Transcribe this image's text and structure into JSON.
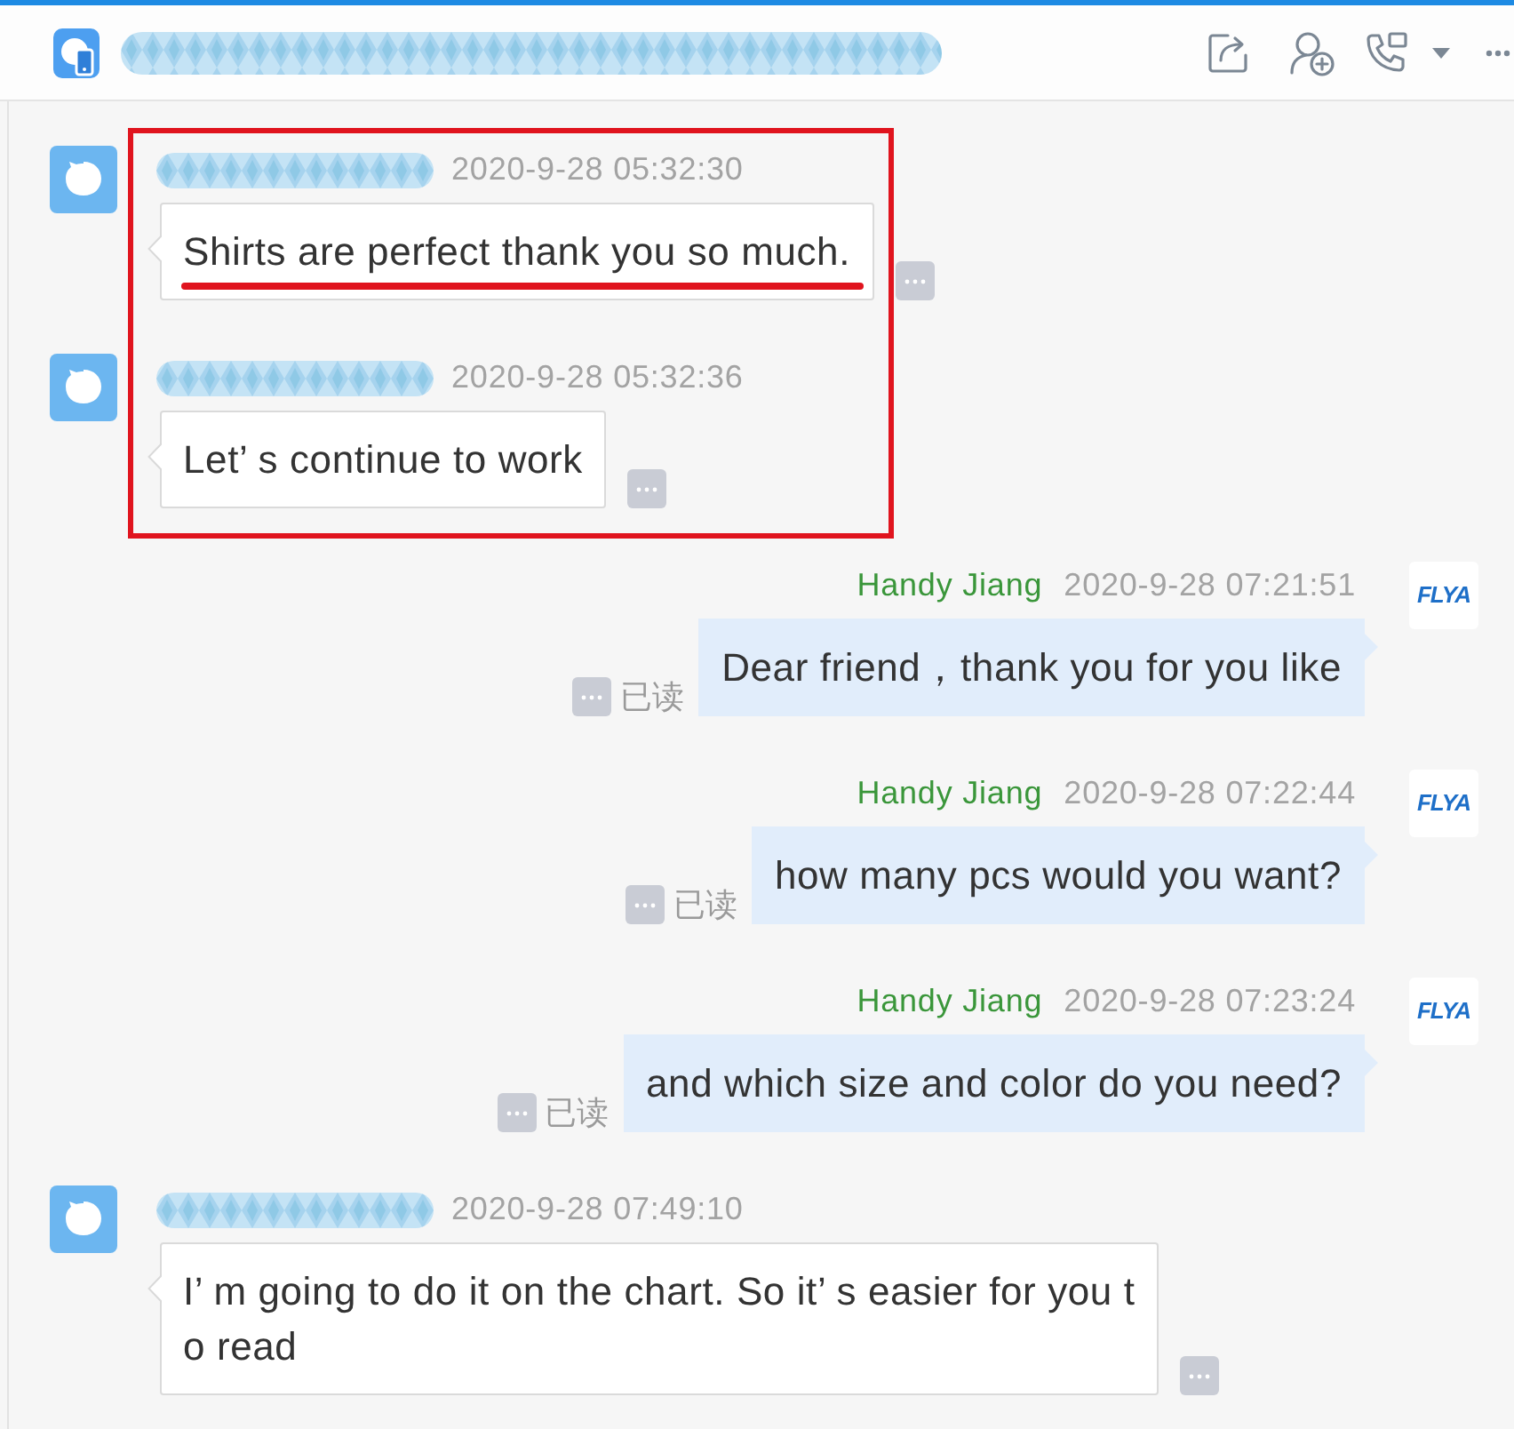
{
  "header": {
    "contact_name_hidden": true
  },
  "messages": [
    {
      "kind": "incoming",
      "sender_hidden": true,
      "time": "2020-9-28 05:32:30",
      "lines": [
        "Shirts are perfect thank you so much."
      ],
      "highlighted": true,
      "underlined": true
    },
    {
      "kind": "incoming",
      "sender_hidden": true,
      "time": "2020-9-28 05:32:36",
      "lines": [
        "Let’ s continue to work"
      ],
      "highlighted": true,
      "underlined": false
    },
    {
      "kind": "outgoing",
      "sender": "Handy Jiang",
      "time": "2020-9-28 07:21:51",
      "lines": [
        "Dear friend，thank you for you like"
      ],
      "status": "已读",
      "avatar_text": "FLYA",
      "highlighted": false,
      "underlined": false
    },
    {
      "kind": "outgoing",
      "sender": "Handy Jiang",
      "time": "2020-9-28 07:22:44",
      "lines": [
        "how many pcs would you want?"
      ],
      "status": "已读",
      "avatar_text": "FLYA",
      "highlighted": false,
      "underlined": false
    },
    {
      "kind": "outgoing",
      "sender": "Handy Jiang",
      "time": "2020-9-28 07:23:24",
      "lines": [
        "and which size and color do you need?"
      ],
      "status": "已读",
      "avatar_text": "FLYA",
      "highlighted": false,
      "underlined": false
    },
    {
      "kind": "incoming",
      "sender_hidden": true,
      "time": "2020-9-28 07:49:10",
      "lines": [
        "I’ m going to do it on the chart. So it’ s easier for you t",
        "o read"
      ],
      "highlighted": false,
      "underlined": false
    }
  ]
}
